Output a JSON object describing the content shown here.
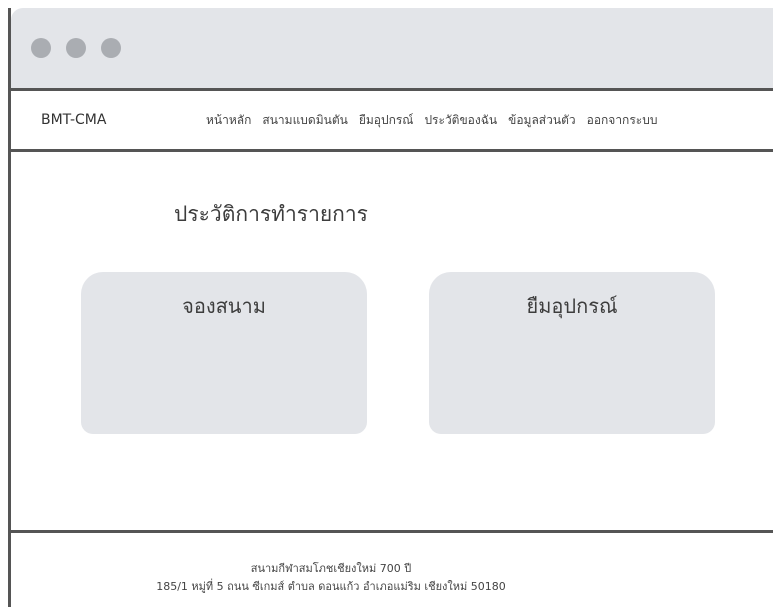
{
  "window": {
    "controls": [
      "close-dot",
      "minimize-dot",
      "maximize-dot"
    ]
  },
  "navbar": {
    "brand": "BMT-CMA",
    "links": [
      "หน้าหลัก",
      "สนามแบดมินตัน",
      "ยืมอุปกรณ์",
      "ประวัติของฉัน",
      "ข้อมูลส่วนตัว",
      "ออกจากระบบ"
    ]
  },
  "main": {
    "title": "ประวัติการทำรายการ",
    "cards": [
      {
        "label": "จองสนาม"
      },
      {
        "label": "ยืมอุปกรณ์"
      }
    ]
  },
  "footer": {
    "name": "สนามกีฬาสมโภชเชียงใหม่ 700 ปี",
    "address": "185/1 หมู่ที่ 5 ถนน ซีเกมส์ ตำบล ดอนแก้ว อำเภอแม่ริม เชียงใหม่ 50180"
  },
  "colors": {
    "placeholder_gray": "#e3e5e9",
    "border": "#555555",
    "window_dot": "#aaadb2"
  }
}
